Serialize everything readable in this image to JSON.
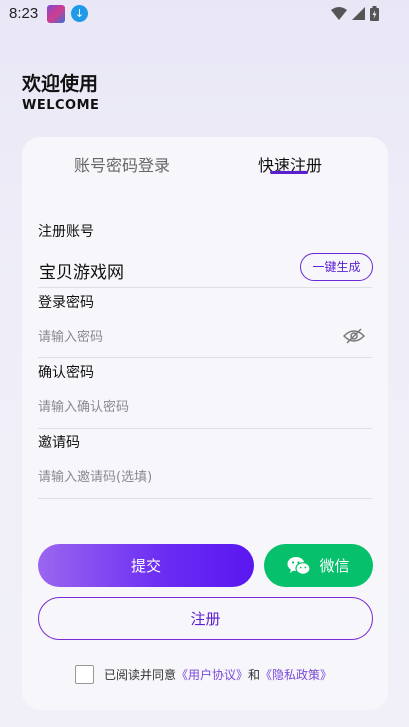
{
  "status_bar": {
    "time": "8:23"
  },
  "header": {
    "title": "欢迎使用",
    "subtitle": "WELCOME"
  },
  "tabs": {
    "login": "账号密码登录",
    "register": "快速注册",
    "active": "register"
  },
  "form": {
    "account": {
      "label": "注册账号",
      "value": "宝贝游戏网",
      "generate_label": "一键生成"
    },
    "password": {
      "label": "登录密码",
      "placeholder": "请输入密码"
    },
    "confirm": {
      "label": "确认密码",
      "placeholder": "请输入确认密码"
    },
    "invite": {
      "label": "邀请码",
      "placeholder": "请输入邀请码(选填)"
    }
  },
  "actions": {
    "submit": "提交",
    "wechat": "微信",
    "register": "注册"
  },
  "agreement": {
    "prefix": "已阅读并同意",
    "user_agreement": "《用户协议》",
    "and": "和",
    "privacy_policy": "《隐私政策》",
    "checked": false
  },
  "colors": {
    "accent": "#5a1fd0",
    "wechat": "#07c06c"
  },
  "icons": [
    "app-thumbnail-icon",
    "download-icon",
    "wifi-icon",
    "signal-icon",
    "battery-icon",
    "eye-hidden-icon",
    "wechat-icon"
  ]
}
